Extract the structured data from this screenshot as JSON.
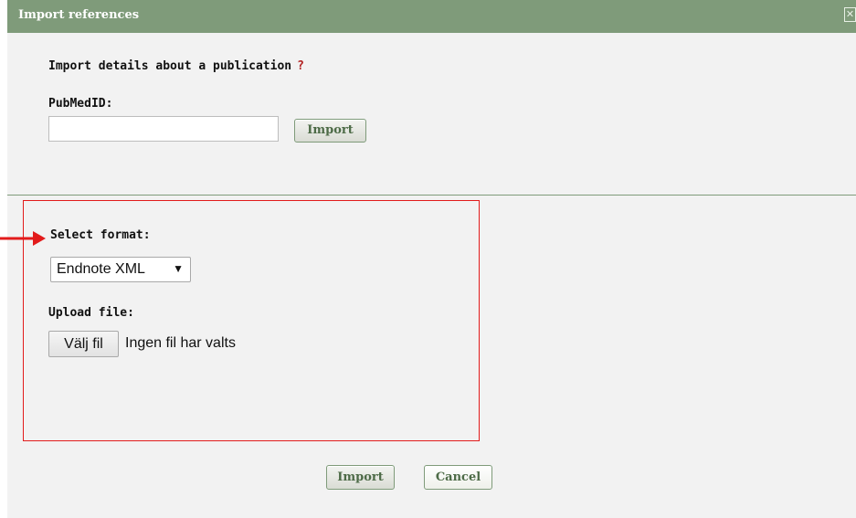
{
  "dialog": {
    "title": "Import references",
    "close_symbol": "✕",
    "close_icon": "close-icon"
  },
  "publication": {
    "heading": "Import details about a publication",
    "help_mark": "?",
    "pubmed_label": "PubMedID:",
    "pubmed_value": "",
    "import_button_label": "Import"
  },
  "file_import": {
    "format_label": "Select format:",
    "format_selected": "Endnote XML",
    "upload_label": "Upload file:",
    "choose_file_label": "Välj fil",
    "no_file_text": "Ingen fil har valts"
  },
  "footer": {
    "import_label": "Import",
    "cancel_label": "Cancel"
  },
  "annotation": {
    "color": "#e21b1b",
    "arrow_icon": "right-arrow-icon"
  },
  "colors": {
    "titlebar": "#7f9b7a",
    "button_text": "#4d6b47",
    "panel_background": "#f2f2f2"
  }
}
